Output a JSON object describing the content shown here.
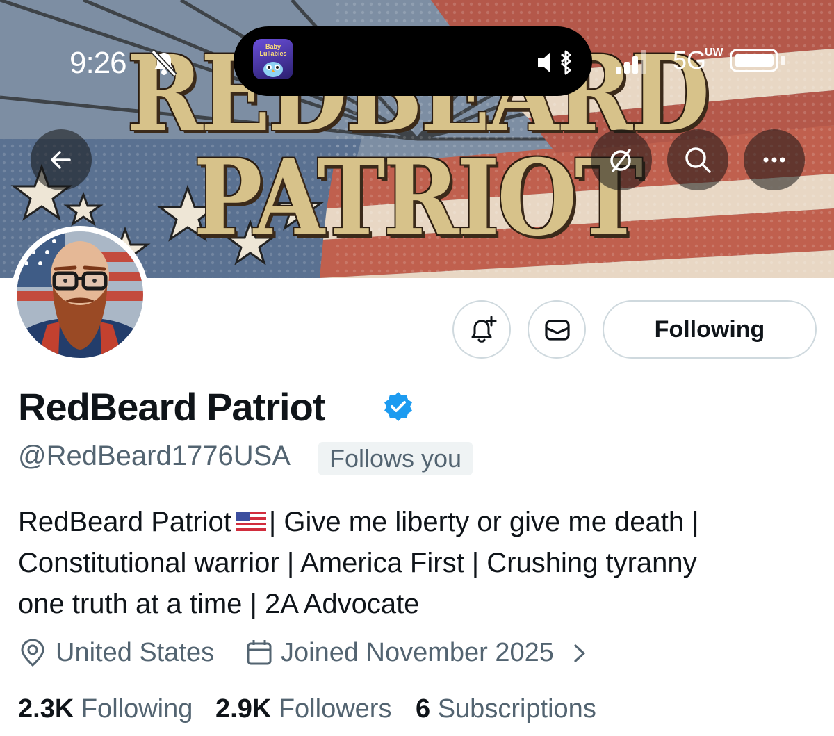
{
  "status_bar": {
    "time": "9:26",
    "network": "5G",
    "network_sub": "UW",
    "island_app_name": "Baby Lullabies"
  },
  "banner": {
    "title": "REDBEARD PATRIOT"
  },
  "nav": {
    "back_icon": "arrow-left-icon",
    "grok_icon": "slash-circle-icon",
    "search_icon": "search-icon",
    "more_icon": "more-icon"
  },
  "profile": {
    "display_name": "RedBeard Patriot",
    "handle": "@RedBeard1776USA",
    "follows_you": "Follows you",
    "following_button": "Following",
    "bio_line_1_before_flag": "RedBeard Patriot",
    "bio_line_1_after_flag": "| Give me liberty or give me death |",
    "bio_line_2": "Constitutional warrior | America First | Crushing tyranny",
    "bio_line_3": "one truth at a time | 2A Advocate",
    "location": "United States",
    "joined": "Joined November 2025",
    "verified_color": "#1d9bf0"
  },
  "stats": {
    "following_count": "2.3K",
    "following_label": "Following",
    "followers_count": "2.9K",
    "followers_label": "Followers",
    "subscriptions_count": "6",
    "subscriptions_label": "Subscriptions"
  }
}
